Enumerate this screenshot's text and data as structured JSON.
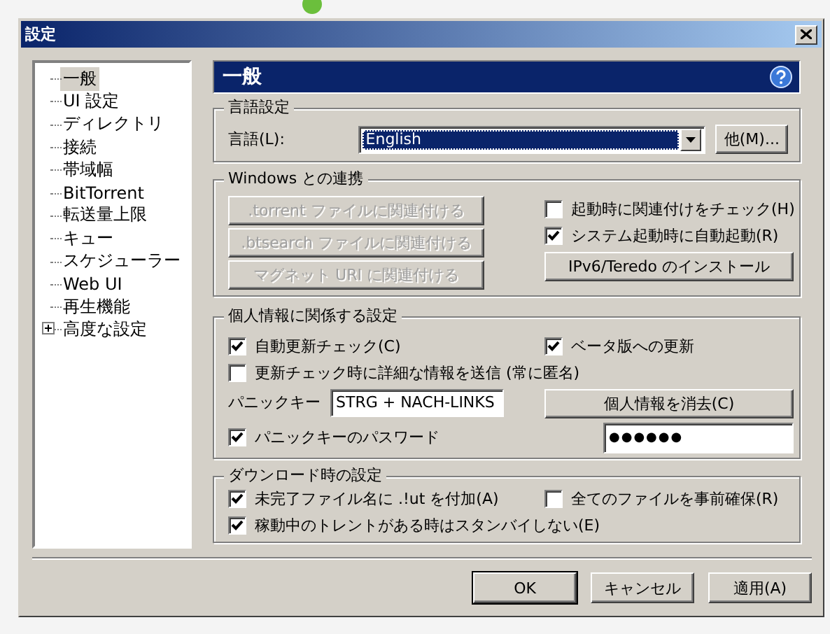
{
  "window": {
    "title": "設定"
  },
  "sidebar": {
    "items": [
      {
        "label": "一般",
        "selected": true
      },
      {
        "label": "UI 設定",
        "selected": false
      },
      {
        "label": "ディレクトリ",
        "selected": false
      },
      {
        "label": "接続",
        "selected": false
      },
      {
        "label": "帯域幅",
        "selected": false
      },
      {
        "label": "BitTorrent",
        "selected": false
      },
      {
        "label": "転送量上限",
        "selected": false
      },
      {
        "label": "キュー",
        "selected": false
      },
      {
        "label": "スケジューラー",
        "selected": false
      },
      {
        "label": "Web UI",
        "selected": false
      },
      {
        "label": "再生機能",
        "selected": false
      },
      {
        "label": "高度な設定",
        "selected": false,
        "expanded": false
      }
    ]
  },
  "header": {
    "title": "一般"
  },
  "language": {
    "title": "言語設定",
    "label": "言語(L):",
    "value": "English",
    "button": "他(M)..."
  },
  "windows": {
    "title": "Windows との連携",
    "buttons": [
      {
        "label": ".torrent ファイルに関連付ける",
        "disabled": true
      },
      {
        "label": ".btsearch ファイルに関連付ける",
        "disabled": true
      },
      {
        "label": "マグネット URI に関連付ける",
        "disabled": true
      }
    ],
    "checks": [
      {
        "label": "起動時に関連付けをチェック(H)",
        "checked": false
      },
      {
        "label": "システム起動時に自動起動(R)",
        "checked": true
      }
    ],
    "install_button": "IPv6/Teredo のインストール"
  },
  "privacy": {
    "title": "個人情報に関係する設定",
    "checks": [
      {
        "label": "自動更新チェック(C)",
        "checked": true
      },
      {
        "label": "ベータ版への更新",
        "checked": true
      },
      {
        "label": "更新チェック時に詳細な情報を送信 (常に匿名)",
        "checked": false
      }
    ],
    "panic_key": {
      "label": "パニックキー",
      "value": "STRG + NACH-LINKS"
    },
    "clear_button": "個人情報を消去(C)",
    "password": {
      "label": "パニックキーのパスワード",
      "checked": true,
      "value": "●●●●●●"
    }
  },
  "download": {
    "title": "ダウンロード時の設定",
    "checks": [
      {
        "label": "未完了ファイル名に .!ut を付加(A)",
        "checked": true
      },
      {
        "label": "全てのファイルを事前確保(R)",
        "checked": false
      },
      {
        "label": "稼動中のトレントがある時はスタンバイしない(E)",
        "checked": true
      }
    ]
  },
  "buttons": [
    {
      "label": "OK",
      "default": true
    },
    {
      "label": "キャンセル",
      "default": false
    },
    {
      "label": "適用(A)",
      "default": false
    }
  ]
}
